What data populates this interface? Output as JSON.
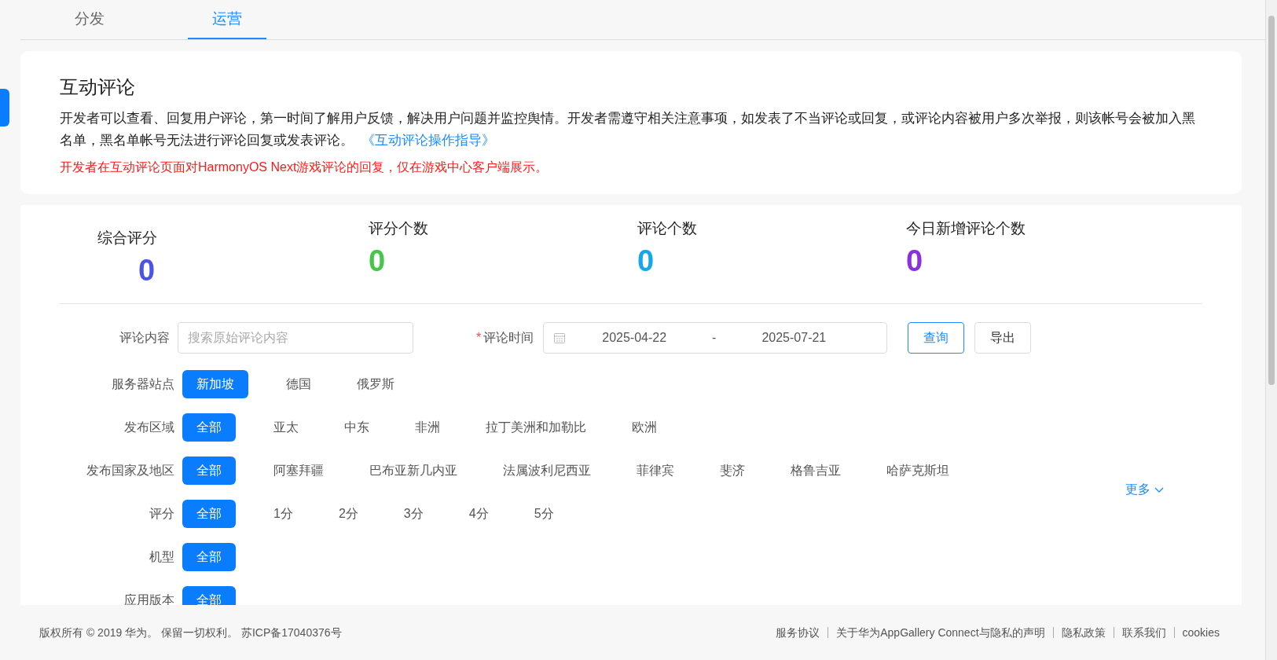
{
  "tabs": [
    {
      "label": "分发",
      "selected": false
    },
    {
      "label": "运营",
      "selected": true
    }
  ],
  "intro": {
    "title": "互动评论",
    "description": "开发者可以查看、回复用户评论，第一时间了解用户反馈，解决用户问题并监控舆情。开发者需遵守相关注意事项，如发表了不当评论或回复，或评论内容被用户多次举报，则该帐号会被加入黑名单，黑名单帐号无法进行评论回复或发表评论。",
    "link": "《互动评论操作指导》",
    "notice": "开发者在互动评论页面对HarmonyOS Next游戏评论的回复，仅在游戏中心客户端展示。"
  },
  "stats": [
    {
      "label": "综合评分",
      "value": "0",
      "color": "#4a56e2"
    },
    {
      "label": "评分个数",
      "value": "0",
      "color": "#43c64a"
    },
    {
      "label": "评论个数",
      "value": "0",
      "color": "#14a8ea"
    },
    {
      "label": "今日新增评论个数",
      "value": "0",
      "color": "#8b2fe0"
    }
  ],
  "search": {
    "label": "评论内容",
    "placeholder": "搜索原始评论内容"
  },
  "date": {
    "label": "评论时间",
    "required_mark": "*",
    "start": "2025-04-22",
    "separator": "-",
    "end": "2025-07-21"
  },
  "buttons": [
    {
      "label": "查询",
      "kind": "primary"
    },
    {
      "label": "导出",
      "kind": "plain"
    }
  ],
  "option_rows": [
    {
      "label": "服务器站点",
      "options": [
        {
          "label": "新加坡",
          "selected": true
        },
        {
          "label": "德国",
          "selected": false
        },
        {
          "label": "俄罗斯",
          "selected": false
        }
      ]
    },
    {
      "label": "发布区域",
      "options": [
        {
          "label": "全部",
          "selected": true
        },
        {
          "label": "亚太",
          "selected": false
        },
        {
          "label": "中东",
          "selected": false
        },
        {
          "label": "非洲",
          "selected": false
        },
        {
          "label": "拉丁美洲和加勒比",
          "selected": false
        },
        {
          "label": "欧洲",
          "selected": false
        }
      ]
    },
    {
      "label": "发布国家及地区",
      "more": "更多",
      "options": [
        {
          "label": "全部",
          "selected": true
        },
        {
          "label": "阿塞拜疆",
          "selected": false
        },
        {
          "label": "巴布亚新几内亚",
          "selected": false
        },
        {
          "label": "法属波利尼西亚",
          "selected": false
        },
        {
          "label": "菲律宾",
          "selected": false
        },
        {
          "label": "斐济",
          "selected": false
        },
        {
          "label": "格鲁吉亚",
          "selected": false
        },
        {
          "label": "哈萨克斯坦",
          "selected": false
        }
      ]
    },
    {
      "label": "评分",
      "options": [
        {
          "label": "全部",
          "selected": true
        },
        {
          "label": "1分",
          "selected": false
        },
        {
          "label": "2分",
          "selected": false
        },
        {
          "label": "3分",
          "selected": false
        },
        {
          "label": "4分",
          "selected": false
        },
        {
          "label": "5分",
          "selected": false
        }
      ]
    },
    {
      "label": "机型",
      "options": [
        {
          "label": "全部",
          "selected": true
        }
      ]
    },
    {
      "label": "应用版本",
      "options": [
        {
          "label": "全部",
          "selected": true
        }
      ]
    }
  ],
  "footer": {
    "copyright": "版权所有 © 2019 华为。 保留一切权利。 苏ICP备17040376号",
    "links": [
      "服务协议",
      "关于华为AppGallery Connect与隐私的声明",
      "隐私政策",
      "联系我们",
      "cookies"
    ]
  }
}
